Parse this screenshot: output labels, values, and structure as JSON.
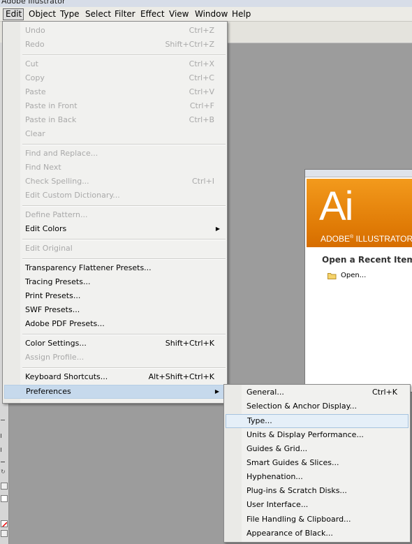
{
  "window": {
    "title": "Adobe Illustrator"
  },
  "menubar": {
    "items": [
      "Edit",
      "Object",
      "Type",
      "Select",
      "Filter",
      "Effect",
      "View",
      "Window",
      "Help"
    ],
    "active": "Edit"
  },
  "edit_menu": {
    "items": [
      {
        "label": "Undo",
        "shortcut": "Ctrl+Z",
        "enabled": false
      },
      {
        "label": "Redo",
        "shortcut": "Shift+Ctrl+Z",
        "enabled": false
      },
      {
        "label": "Cut",
        "shortcut": "Ctrl+X",
        "enabled": false
      },
      {
        "label": "Copy",
        "shortcut": "Ctrl+C",
        "enabled": false
      },
      {
        "label": "Paste",
        "shortcut": "Ctrl+V",
        "enabled": false
      },
      {
        "label": "Paste in Front",
        "shortcut": "Ctrl+F",
        "enabled": false
      },
      {
        "label": "Paste in Back",
        "shortcut": "Ctrl+B",
        "enabled": false
      },
      {
        "label": "Clear",
        "shortcut": "",
        "enabled": false
      },
      {
        "label": "Find and Replace...",
        "shortcut": "",
        "enabled": false
      },
      {
        "label": "Find Next",
        "shortcut": "",
        "enabled": false
      },
      {
        "label": "Check Spelling...",
        "shortcut": "Ctrl+I",
        "enabled": false
      },
      {
        "label": "Edit Custom Dictionary...",
        "shortcut": "",
        "enabled": false
      },
      {
        "label": "Define Pattern...",
        "shortcut": "",
        "enabled": false
      },
      {
        "label": "Edit Colors",
        "shortcut": "",
        "enabled": true,
        "submenu": true
      },
      {
        "label": "Edit Original",
        "shortcut": "",
        "enabled": false
      },
      {
        "label": "Transparency Flattener Presets...",
        "shortcut": "",
        "enabled": true
      },
      {
        "label": "Tracing Presets...",
        "shortcut": "",
        "enabled": true
      },
      {
        "label": "Print Presets...",
        "shortcut": "",
        "enabled": true
      },
      {
        "label": "SWF Presets...",
        "shortcut": "",
        "enabled": true
      },
      {
        "label": "Adobe PDF Presets...",
        "shortcut": "",
        "enabled": true
      },
      {
        "label": "Color Settings...",
        "shortcut": "Shift+Ctrl+K",
        "enabled": true
      },
      {
        "label": "Assign Profile...",
        "shortcut": "",
        "enabled": false
      },
      {
        "label": "Keyboard Shortcuts...",
        "shortcut": "Alt+Shift+Ctrl+K",
        "enabled": true
      },
      {
        "label": "Preferences",
        "shortcut": "",
        "enabled": true,
        "submenu": true,
        "highlighted": true
      }
    ]
  },
  "preferences_menu": {
    "items": [
      {
        "label": "General...",
        "shortcut": "Ctrl+K"
      },
      {
        "label": "Selection & Anchor Display...",
        "shortcut": ""
      },
      {
        "label": "Type...",
        "shortcut": "",
        "highlighted": true
      },
      {
        "label": "Units & Display Performance...",
        "shortcut": ""
      },
      {
        "label": "Guides & Grid...",
        "shortcut": ""
      },
      {
        "label": "Smart Guides & Slices...",
        "shortcut": ""
      },
      {
        "label": "Hyphenation...",
        "shortcut": ""
      },
      {
        "label": "Plug-ins & Scratch Disks...",
        "shortcut": ""
      },
      {
        "label": "User Interface...",
        "shortcut": ""
      },
      {
        "label": "File Handling & Clipboard...",
        "shortcut": ""
      },
      {
        "label": "Appearance of Black...",
        "shortcut": ""
      }
    ]
  },
  "welcome": {
    "logo_text": "Ai",
    "product_name": "ADOBE",
    "product_suffix": "ILLUSTRATOR",
    "reg_mark": "®",
    "recent_title": "Open a Recent Item",
    "open_label": "Open..."
  },
  "colors": {
    "menu_bg": "#f1f1ef",
    "highlight": "#c6d9ec",
    "disabled_text": "#a9a9a9",
    "brand_orange": "#e98a10",
    "workspace": "#9c9c9c"
  }
}
